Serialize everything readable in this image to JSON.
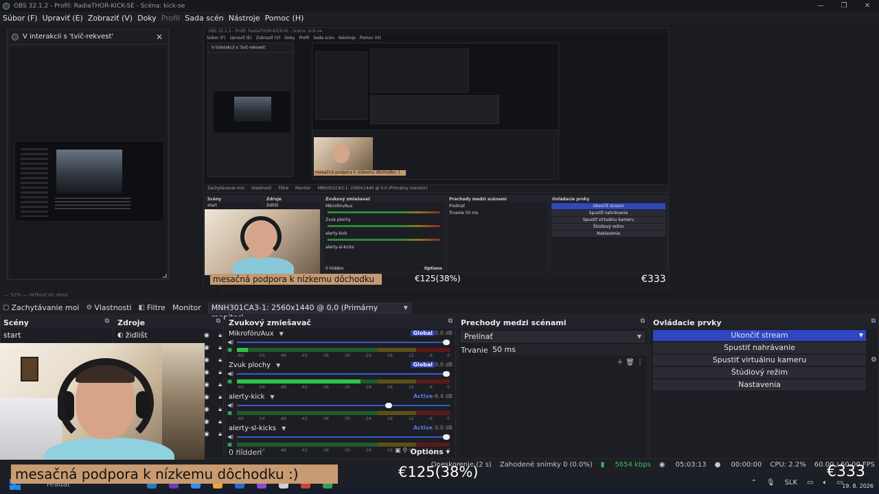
{
  "window": {
    "title": "OBS 32.1.2 - Profil: RadiaTHOR-KICK-SE - Scéna: kick-se",
    "controls": [
      "—",
      "❐",
      "✕"
    ]
  },
  "menu": {
    "items": [
      "Súbor (F)",
      "Upraviť (E)",
      "Zobraziť (V)",
      "Doky",
      "Profil",
      "Sada scén",
      "Nástroje",
      "Pomoc (H)"
    ]
  },
  "interact_dock": {
    "title": "V interakcii s 'tvič-rekvest'",
    "close": "✕"
  },
  "zoom": {
    "text": "— 52% —   Veľkosť do okna"
  },
  "inner": {
    "title": "OBS 32.1.2 - Profil: RadiaTHOR-KICK-SE - Scéna: kick-se",
    "menu": [
      "Súbor (F)",
      "Upraviť (E)",
      "Zobraziť (V)",
      "Doky",
      "Profil",
      "Sada scén",
      "Nástroje",
      "Pomoc (H)"
    ],
    "dock_title": "V interakcii s 'tvič-rekvest'",
    "tabs": [
      "Zachytávanie moi",
      "Vlastnosti",
      "Filtre",
      "Monitor",
      "MNH301CA3-1: 2560x1440 @ 0,0 (Primárny monitor)"
    ],
    "scenes_h": "Scény",
    "sources_h": "Zdroje",
    "mixer_h": "Zvukový zmiešavač",
    "trans_h": "Prechody medzi scénami",
    "ctrl_h": "Ovládacie prvky",
    "start": "start",
    "zidlist": "židlišt",
    "tracks": [
      "Mikrofón/Aux",
      "Zvuk plochy",
      "alerty-kick",
      "alerty-sl-kicks"
    ],
    "hidden": "0 hidden",
    "options": "Options",
    "trans_sel": "Prelínať",
    "duration": "Trvanie",
    "duration_val": "50 ms",
    "buttons": [
      "Ukončiť stream",
      "Spustiť nahrávanie",
      "Spustiť virtuálnu kameru",
      "Štúdiový režim",
      "Nastavenia"
    ],
    "overlay": "mesačná podpora k nízkemu dôchodku :)",
    "money": "€125(38%)",
    "euro": "€333"
  },
  "toolbar": {
    "capture": "Zachytávanie moi",
    "properties": "Vlastnosti",
    "filters": "Filtre",
    "monitor_label": "Monitor",
    "monitor_value": "MNH301CA3-1: 2560x1440 @ 0,0 (Primárny monitor)"
  },
  "scenes": {
    "header": "Scény",
    "items": [
      "start"
    ]
  },
  "sources": {
    "header": "Zdroje",
    "items": [
      "židlišt"
    ]
  },
  "mixer": {
    "header": "Zvukový zmiešavač",
    "tracks": [
      {
        "name": "Mikrofón/Aux",
        "badge": "Global",
        "db": "0.0 dB",
        "volume": 1.0,
        "level": 0.05
      },
      {
        "name": "Zvuk plochy",
        "badge": "Global",
        "db": "0.0 dB",
        "volume": 1.0,
        "level": 0.58
      },
      {
        "name": "alerty-kick",
        "badge": "Active",
        "db": "-6.4 dB",
        "volume": 0.73,
        "level": 0.0
      },
      {
        "name": "alerty-sl-kicks",
        "badge": "Active",
        "db": "0.0 dB",
        "volume": 1.0,
        "level": 0.0
      }
    ],
    "ticks": [
      "-60",
      "-54",
      "-48",
      "-42",
      "-36",
      "-30",
      "-24",
      "-18",
      "-12",
      "-6",
      "0"
    ],
    "hidden": "0 hidden",
    "options": "Options"
  },
  "transitions": {
    "header": "Prechody medzi scénami",
    "selected": "Prelínať",
    "duration_label": "Trvanie",
    "duration_value": "50 ms"
  },
  "controls": {
    "header": "Ovládacie prvky",
    "buttons": [
      "Ukončiť stream",
      "Spustiť nahrávanie",
      "Spustiť virtuálnu kameru",
      "Štúdiový režim",
      "Nastavenia"
    ]
  },
  "status": {
    "delay": "Oneskorenie (2 s)",
    "dropped": "Zahodené snímky 0 (0.0%)",
    "bitrate": "5654 kbps",
    "live_time": "05:03:13",
    "rec_time": "00:00:00",
    "cpu": "CPU: 2.2%",
    "fps": "60.00 / 60.00 FPS"
  },
  "overlay": {
    "support_text": "mesačná podpora k nízkemu dôchodku :)",
    "money": "€125(38%)",
    "euro": "€333"
  },
  "taskbar": {
    "search": "Hľadať",
    "lang": "SLK",
    "date": "19. 8. 2026"
  },
  "colors": {
    "accent": "#2f46c2",
    "meter_green": "#2fc24a",
    "overlay_bg": "#c89b72"
  }
}
